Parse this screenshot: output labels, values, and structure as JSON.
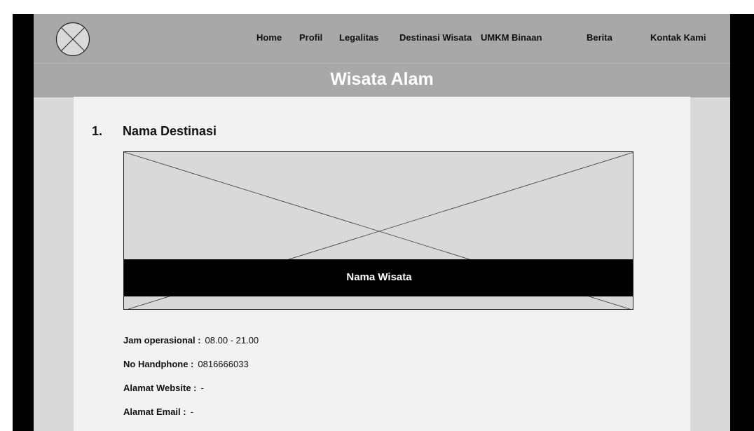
{
  "nav": {
    "logo_icon": "image-placeholder-icon",
    "items": [
      "Home",
      "Profil",
      "Legalitas",
      "Destinasi Wisata",
      "UMKM Binaan",
      "Berita",
      "Kontak Kami"
    ]
  },
  "banner": {
    "title": "Wisata Alam"
  },
  "destination": {
    "number": "1.",
    "name": "Nama Destinasi",
    "image_caption": "Nama Wisata",
    "image_icon": "image-placeholder-icon",
    "details": [
      {
        "label": "Jam operasional :",
        "value": "08.00 - 21.00"
      },
      {
        "label": "No Handphone :",
        "value": "0816666033"
      },
      {
        "label": "Alamat Website :",
        "value": "-"
      },
      {
        "label": "Alamat Email :",
        "value": "-"
      }
    ]
  },
  "colors": {
    "navbar": "#a8a8a8",
    "background": "#d9d9d9",
    "content": "#f2f2f2",
    "frame": "#000000",
    "banner_text": "#ffffff"
  }
}
